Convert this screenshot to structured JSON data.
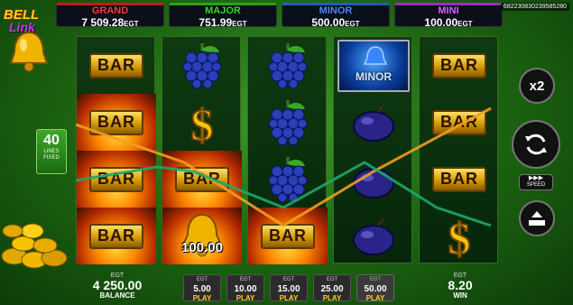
{
  "logo": {
    "line1": "BELL",
    "line2": "Link"
  },
  "jackpots": [
    {
      "name": "GRAND",
      "value": "7 509.28",
      "currency": "EGT"
    },
    {
      "name": "MAJOR",
      "value": "751.99",
      "currency": "EGT"
    },
    {
      "name": "MINOR",
      "value": "500.00",
      "currency": "EGT"
    },
    {
      "name": "MINI",
      "value": "100.00",
      "currency": "EGT"
    }
  ],
  "game_id": "682230830239585280",
  "lines": {
    "count": "40",
    "label1": "LINES",
    "label2": "FIXED"
  },
  "symbols": {
    "minor_label": "MINOR",
    "bar_text": "BAR",
    "bell_prize": "100.00"
  },
  "controls": {
    "multiplier": "x2",
    "speed_label": "SPEED",
    "speed_arrows": "▶▶▶"
  },
  "balance": {
    "currency": "EGT",
    "value": "4 250.00",
    "label": "BALANCE"
  },
  "win": {
    "currency": "EGT",
    "value": "8.20",
    "label": "WIN"
  },
  "bets": [
    {
      "currency": "EGT",
      "value": "5.00",
      "play": "PLAY",
      "active": false
    },
    {
      "currency": "EGT",
      "value": "10.00",
      "play": "PLAY",
      "active": false
    },
    {
      "currency": "EGT",
      "value": "15.00",
      "play": "PLAY",
      "active": false
    },
    {
      "currency": "EGT",
      "value": "25.00",
      "play": "PLAY",
      "active": false
    },
    {
      "currency": "EGT",
      "value": "50.00",
      "play": "PLAY",
      "active": true
    }
  ],
  "colors": {
    "grand": "#c81919",
    "major": "#2aa31c",
    "minor": "#1f5cc9",
    "mini": "#9b2fc0",
    "payline_orange": "#f0a020",
    "payline_green": "#1fa66a"
  }
}
